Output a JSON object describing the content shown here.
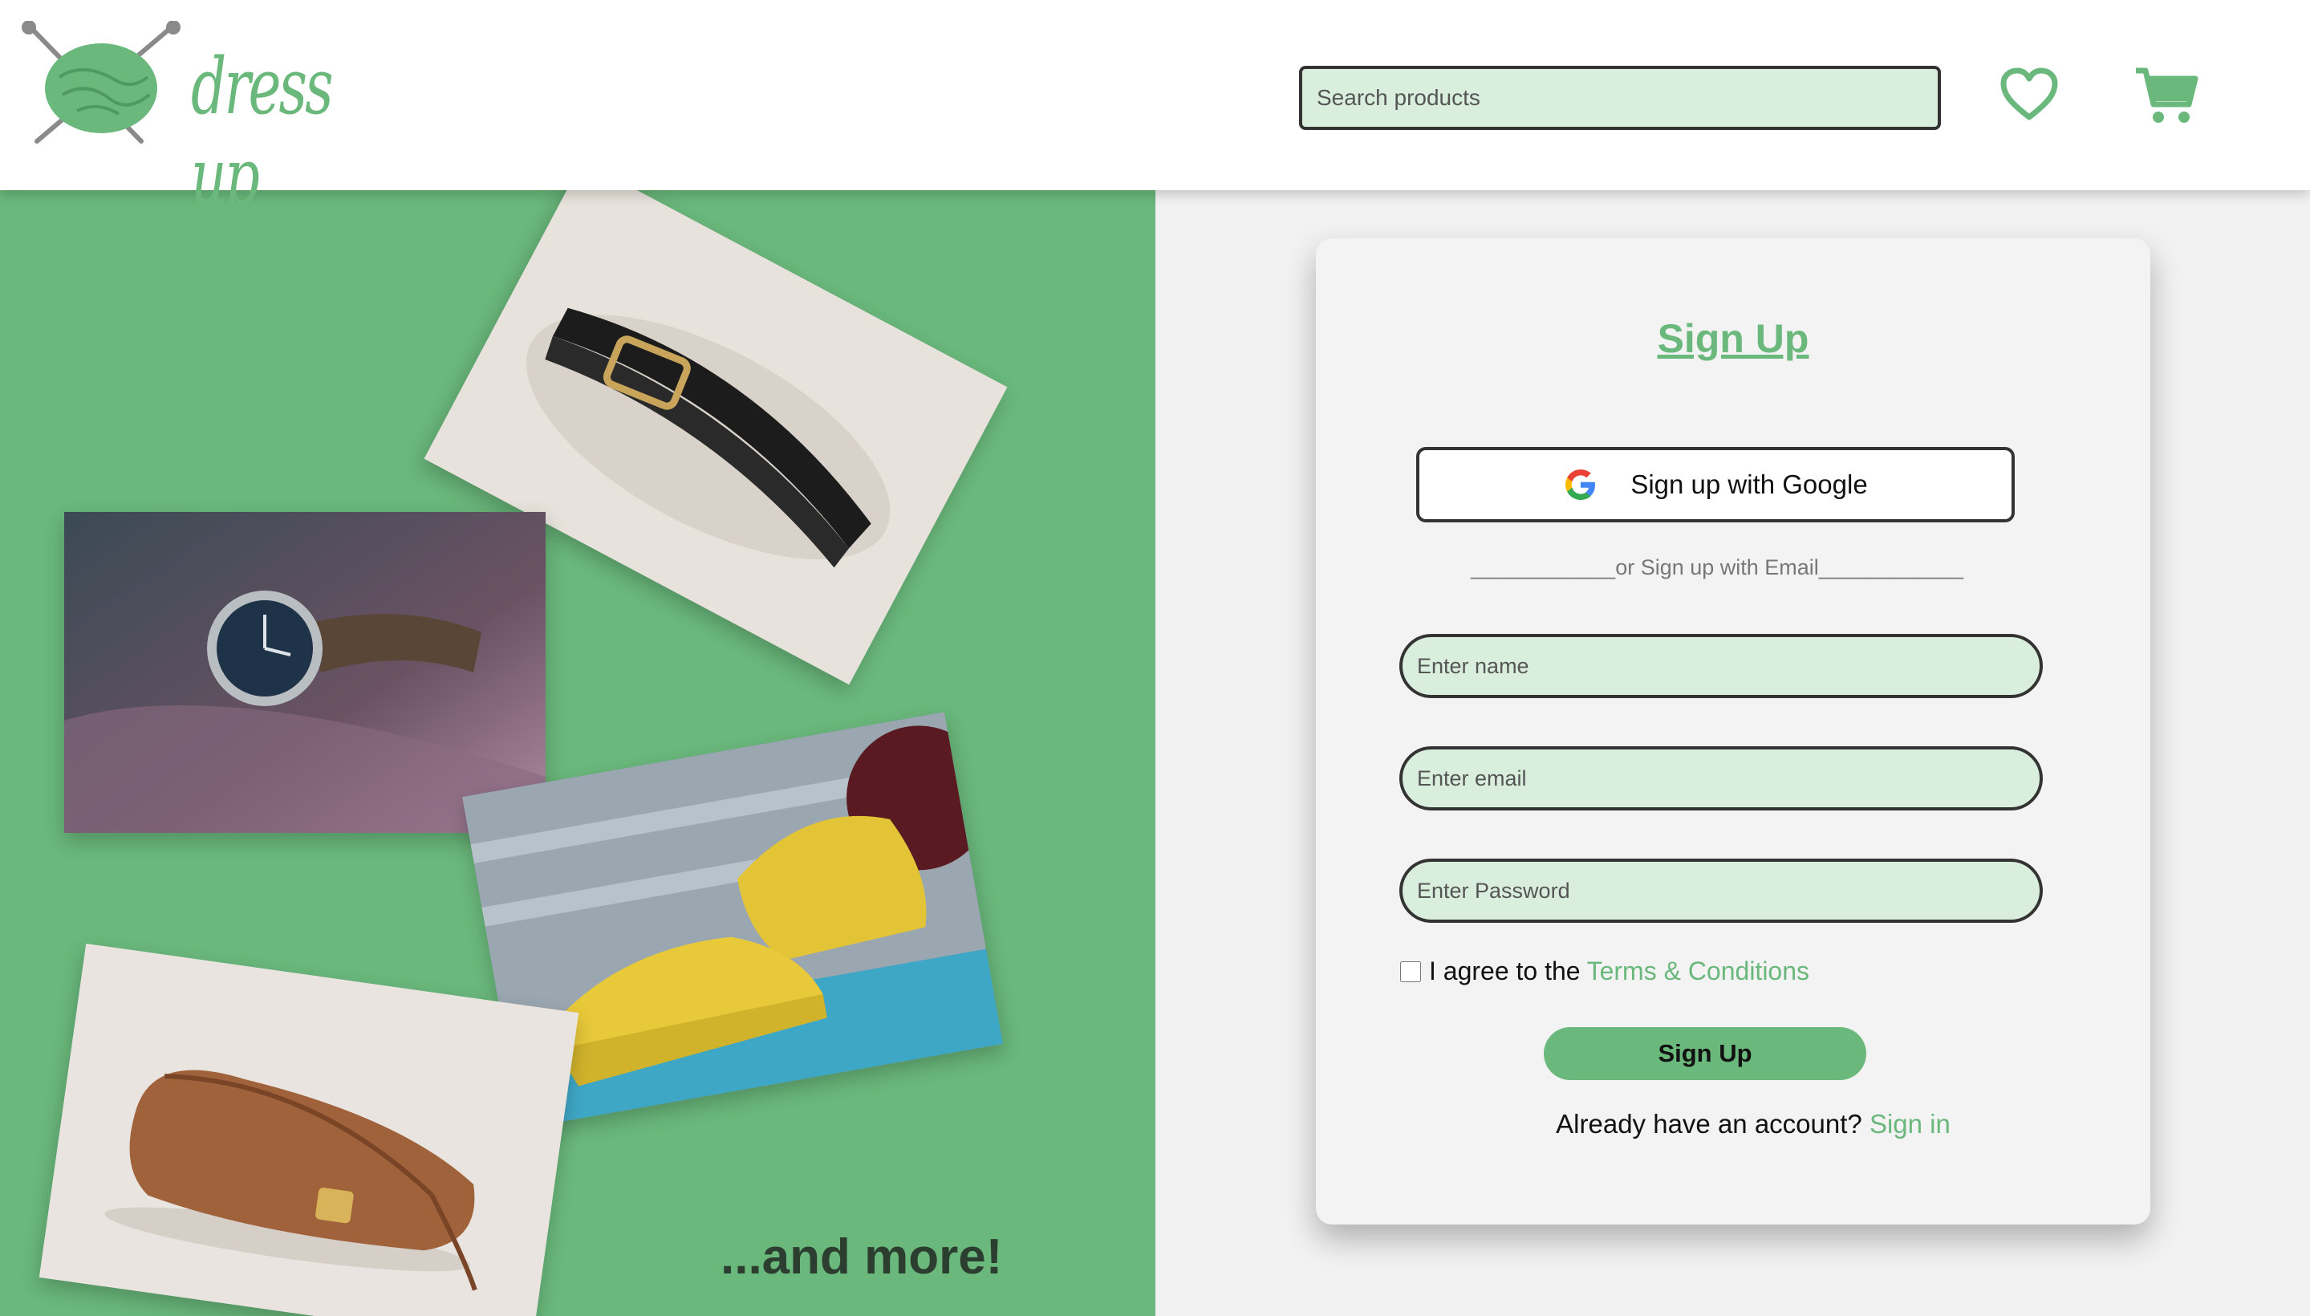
{
  "header": {
    "brand": "dress up",
    "search_placeholder": "Search products",
    "icons": {
      "wishlist": "heart-icon",
      "cart": "cart-icon"
    }
  },
  "hero": {
    "more_text": "...and more!",
    "photos": [
      "belt-photo",
      "watch-photo",
      "sneakers-photo",
      "handbag-photo"
    ]
  },
  "signup": {
    "title": "Sign Up",
    "google_label": "Sign up with Google",
    "divider_text": "____________or Sign up with Email____________",
    "name_placeholder": "Enter name",
    "email_placeholder": "Enter email",
    "password_placeholder": "Enter Password",
    "agree_text": "I agree to the",
    "terms_link": "Terms & Conditions",
    "submit_label": "Sign Up",
    "have_account_text": "Already have an account?",
    "signin_link": "Sign in"
  },
  "colors": {
    "accent": "#6ab87c",
    "input_bg": "#d9eedd",
    "card_bg": "#f3f3f3",
    "page_bg": "#f2f2f2"
  }
}
